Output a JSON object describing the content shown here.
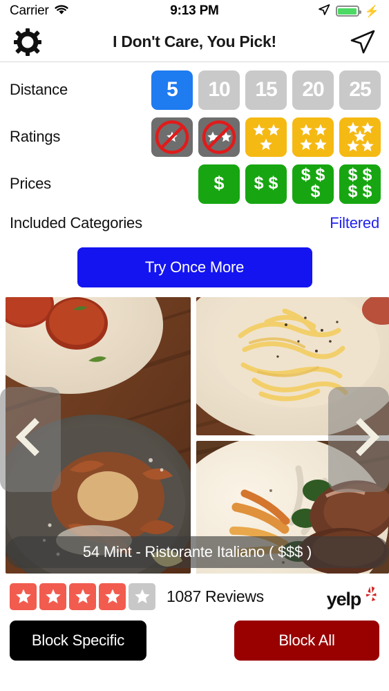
{
  "status_bar": {
    "carrier": "Carrier",
    "time": "9:13 PM",
    "wifi_icon": "wifi-icon",
    "location_icon": "location-arrow-icon",
    "battery_icon": "battery-full-icon",
    "charging_icon": "lightning-bolt-icon",
    "battery_color": "#4CD964"
  },
  "nav": {
    "title": "I Don't Care, You Pick!",
    "left_icon": "gear-icon",
    "right_icon": "navigate-icon"
  },
  "filters": {
    "distance": {
      "label": "Distance",
      "options": [
        {
          "value": "5",
          "selected": true
        },
        {
          "value": "10",
          "selected": false
        },
        {
          "value": "15",
          "selected": false
        },
        {
          "value": "20",
          "selected": false
        },
        {
          "value": "25",
          "selected": false
        }
      ],
      "selected_color": "#1E7BF0",
      "unselected_color": "#C9C9C9"
    },
    "ratings": {
      "label": "Ratings",
      "options": [
        {
          "stars": 1,
          "enabled": false
        },
        {
          "stars": 2,
          "enabled": false
        },
        {
          "stars": 3,
          "enabled": true
        },
        {
          "stars": 4,
          "enabled": true
        },
        {
          "stars": 5,
          "enabled": true
        }
      ],
      "enabled_color": "#F5B914",
      "disabled_color": "#6E6E6E",
      "block_color": "#E01B1B"
    },
    "prices": {
      "label": "Prices",
      "options": [
        {
          "level": 1,
          "symbols": "$"
        },
        {
          "level": 2,
          "symbols": "$$"
        },
        {
          "level": 3,
          "symbols": "$$$"
        },
        {
          "level": 4,
          "symbols": "$$$$"
        }
      ],
      "color": "#17A611"
    }
  },
  "categories": {
    "label": "Included Categories",
    "link": "Filtered",
    "link_color": "#2222EE"
  },
  "try_button": {
    "label": "Try Once More",
    "color": "#1414F0"
  },
  "carousel": {
    "prev_icon": "chevron-left-icon",
    "next_icon": "chevron-right-icon",
    "caption": "54 Mint - Ristorante Italiano ( $$$ )",
    "photos": [
      {
        "alt": "arancini-and-prosciutto-dish-photo"
      },
      {
        "alt": "creamy-pasta-photo"
      },
      {
        "alt": "lamb-chops-with-carrots-photo"
      }
    ]
  },
  "review": {
    "rating": 4,
    "max_rating": 5,
    "reviews_text": "1087 Reviews",
    "star_color": "#F15C4F",
    "empty_star_color": "#C8C8C8",
    "brand": "yelp",
    "brand_color": "#D32323"
  },
  "bottom_actions": {
    "block_specific": {
      "label": "Block Specific",
      "color": "#000000"
    },
    "block_all": {
      "label": "Block All",
      "color": "#990000"
    }
  }
}
